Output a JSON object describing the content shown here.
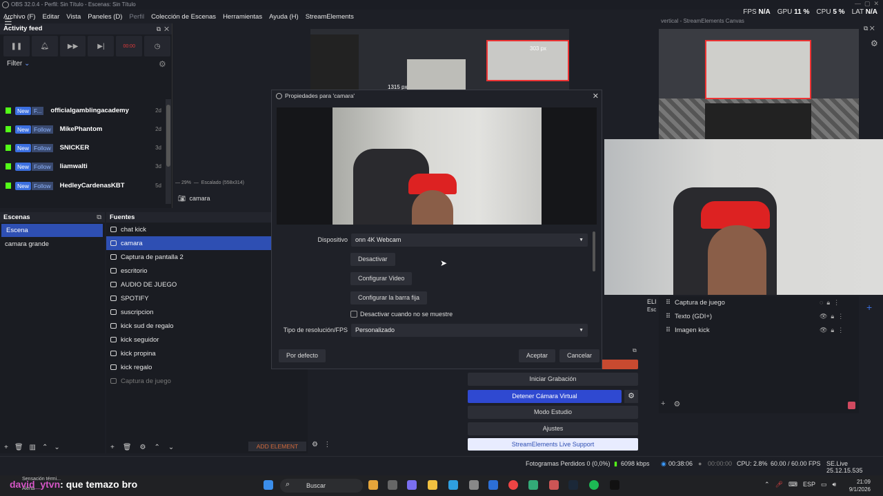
{
  "window_title": "OBS 32.0.4 - Perfil: Sin Título - Escenas: Sin Título",
  "menu": [
    "Archivo (F)",
    "Editar",
    "Vista",
    "Paneles (D)",
    "Perfil",
    "Colección de Escenas",
    "Herramientas",
    "Ayuda (H)",
    "StreamElements"
  ],
  "stats": {
    "fps_label": "FPS",
    "fps": "N/A",
    "gpu_label": "GPU",
    "gpu": "11 %",
    "cpu_label": "CPU",
    "cpu": "5 %",
    "lat_label": "LAT",
    "lat": "N/A"
  },
  "activity": {
    "title": "Activity feed",
    "timer": "00:00",
    "filter": "Filter",
    "items": [
      {
        "badge": "New",
        "type": "F...",
        "name": "officialgamblingacademy",
        "time": "2d"
      },
      {
        "badge": "New",
        "type": "Follow",
        "name": "MikePhantom",
        "time": "2d"
      },
      {
        "badge": "New",
        "type": "Follow",
        "name": "SNICKER",
        "time": "3d"
      },
      {
        "badge": "New",
        "type": "Follow",
        "name": "liamwalti",
        "time": "3d"
      },
      {
        "badge": "New",
        "type": "Follow",
        "name": "HedleyCardenasKBT",
        "time": "5d"
      }
    ]
  },
  "preview": {
    "zoom": "29%",
    "scale": "Escalado (558x314)",
    "selected_source": "camara",
    "px_top": "303 px",
    "px_left": "1315 px"
  },
  "vertical_canvas": {
    "title": "vertical - StreamElements Canvas"
  },
  "scenes": {
    "title": "Escenas",
    "items": [
      "Escena",
      "camara grande"
    ]
  },
  "sources": {
    "title": "Fuentes",
    "items": [
      "chat kick",
      "camara",
      "Captura de pantalla 2",
      "escritorio",
      "AUDIO DE JUEGO",
      "SPOTIFY",
      "suscripcion",
      "kick sud de regalo",
      "kick seguidor",
      "kick propina",
      "kick regalo",
      "Captura de juego"
    ],
    "add_element": "ADD ELEMENT"
  },
  "dialog": {
    "title": "Propiedades para 'camara'",
    "device_label": "Dispositivo",
    "device_value": "onn 4K Webcam",
    "deactivate": "Desactivar",
    "config_video": "Configurar Video",
    "config_crossbar": "Configurar la barra fija",
    "checkbox_label": "Desactivar cuando no se muestre",
    "res_label": "Tipo de resolución/FPS",
    "res_value": "Personalizado",
    "defaults": "Por defecto",
    "accept": "Aceptar",
    "cancel": "Cancelar"
  },
  "controls": {
    "start_recording": "Iniciar Grabación",
    "stop_virtual_cam": "Detener Cámara Virtual",
    "studio_mode": "Modo Estudio",
    "settings": "Ajustes",
    "support": "StreamElements Live Support"
  },
  "right_sources": {
    "items": [
      "Captura de juego",
      "Texto (GDI+)",
      "Imagen kick"
    ],
    "partial": "ELI",
    "partial2": "Esc"
  },
  "status": {
    "dropped": "Fotogramas Perdidos 0 (0,0%)",
    "kbps": "6098 kbps",
    "live_time": "00:38:06",
    "rec_time": "00:00:00",
    "cpu": "CPU: 2.8%",
    "fps": "60.00 / 60.00 FPS",
    "version": "SE.Live 25.12.15.535"
  },
  "taskbar": {
    "notification": "Sensación térmi...",
    "notification2": "Alerta",
    "chat_user": "david_ytvn",
    "chat_msg": ": que temazo bro",
    "search": "Buscar",
    "lang": "ESP",
    "time": "21:09",
    "date": "9/1/2026"
  },
  "colors": {
    "accent": "#2e4fb3",
    "kick": "#53fc18",
    "record": "#e23b3b"
  }
}
